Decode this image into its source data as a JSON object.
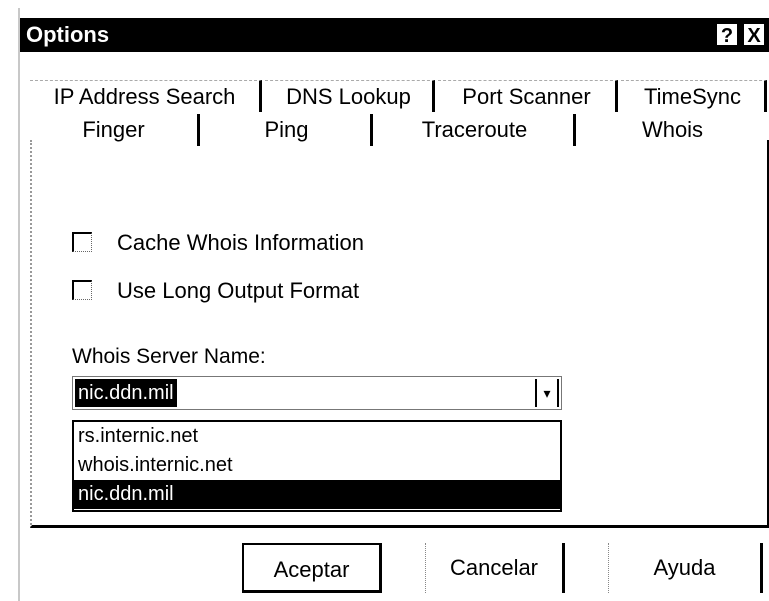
{
  "window": {
    "title": "Options",
    "help_glyph": "?",
    "close_glyph": "X"
  },
  "tabs_row1": [
    "IP Address Search",
    "DNS Lookup",
    "Port Scanner",
    "TimeSync"
  ],
  "tabs_row2": [
    "Finger",
    "Ping",
    "Traceroute",
    "Whois"
  ],
  "active_tab": "Whois",
  "whois": {
    "cache_label": "Cache Whois Information",
    "cache_checked": false,
    "long_output_label": "Use Long Output Format",
    "long_output_checked": false,
    "server_label": "Whois Server Name:",
    "server_value": "nic.ddn.mil",
    "server_options": [
      "rs.internic.net",
      "whois.internic.net",
      "nic.ddn.mil"
    ],
    "selected_option": "nic.ddn.mil"
  },
  "buttons": {
    "ok": "Aceptar",
    "cancel": "Cancelar",
    "help": "Ayuda"
  }
}
